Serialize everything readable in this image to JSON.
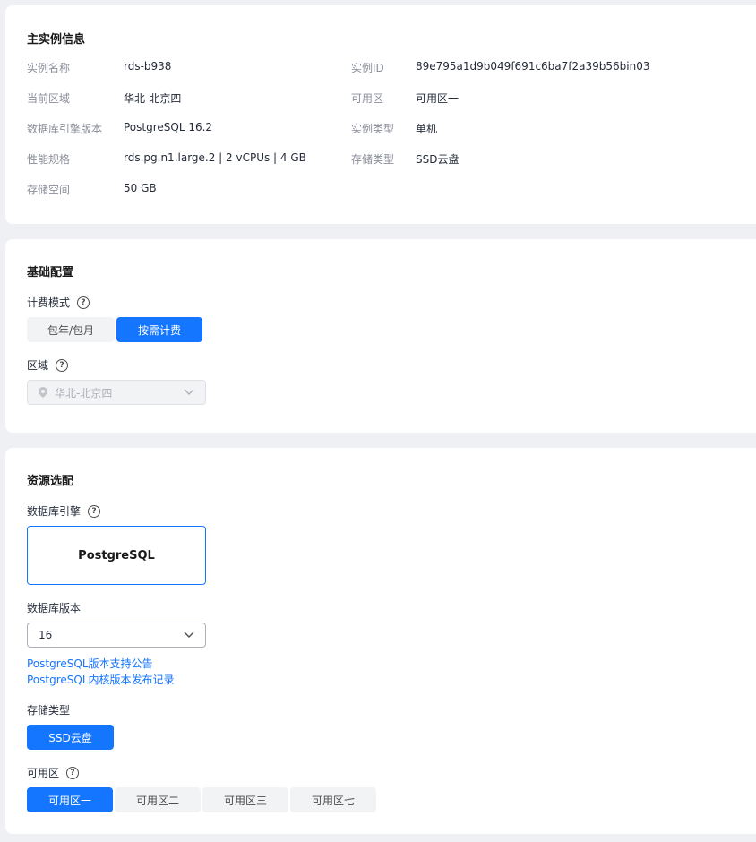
{
  "main_info": {
    "title": "主实例信息",
    "fields": [
      {
        "label": "实例名称",
        "value": "rds-b938"
      },
      {
        "label": "实例ID",
        "value": "89e795a1d9b049f691c6ba7f2a39b56bin03"
      },
      {
        "label": "当前区域",
        "value": "华北-北京四"
      },
      {
        "label": "可用区",
        "value": "可用区一"
      },
      {
        "label": "数据库引擎版本",
        "value": "PostgreSQL 16.2"
      },
      {
        "label": "实例类型",
        "value": "单机"
      },
      {
        "label": "性能规格",
        "value": "rds.pg.n1.large.2 | 2 vCPUs | 4 GB"
      },
      {
        "label": "存储类型",
        "value": "SSD云盘"
      },
      {
        "label": "存储空间",
        "value": "50 GB"
      }
    ]
  },
  "basic": {
    "title": "基础配置",
    "billing_label": "计费模式",
    "billing_options": [
      "包年/包月",
      "按需计费"
    ],
    "billing_selected": "按需计费",
    "region_label": "区域",
    "region_value": "华北-北京四"
  },
  "resource": {
    "title": "资源选配",
    "engine_label": "数据库引擎",
    "engine_value": "PostgreSQL",
    "version_label": "数据库版本",
    "version_value": "16",
    "links": [
      "PostgreSQL版本支持公告",
      "PostgreSQL内核版本发布记录"
    ],
    "storage_label": "存储类型",
    "storage_value": "SSD云盘",
    "az_label": "可用区",
    "az_options": [
      "可用区一",
      "可用区二",
      "可用区三",
      "可用区七"
    ],
    "az_selected": "可用区一"
  },
  "colors": {
    "accent": "#1476ff",
    "background": "#eff0f4"
  },
  "icons": {
    "help": "question-circle-icon",
    "dropdown": "chevron-down-icon",
    "location": "map-pin-icon"
  }
}
